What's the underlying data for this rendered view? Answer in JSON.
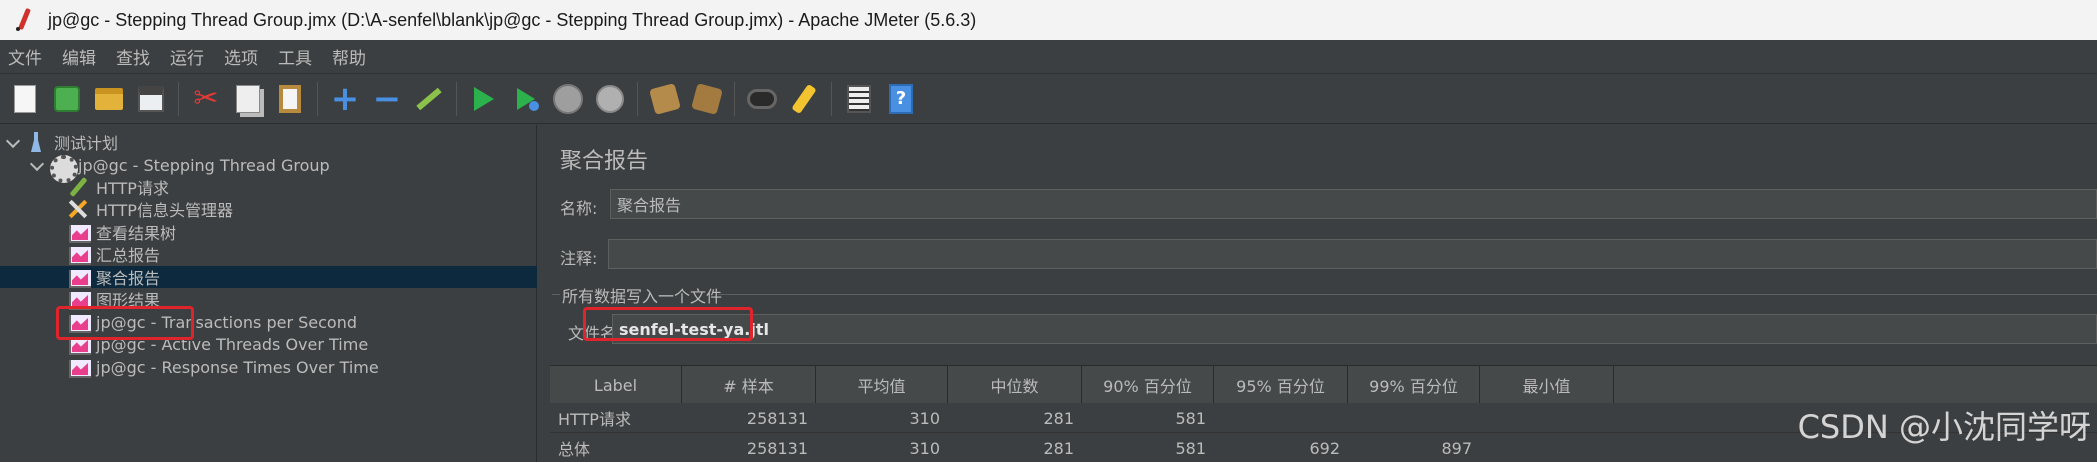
{
  "window": {
    "title": "jp@gc - Stepping Thread Group.jmx (D:\\A-senfel\\blank\\jp@gc - Stepping Thread Group.jmx) - Apache JMeter (5.6.3)"
  },
  "menu": {
    "items": [
      "文件",
      "编辑",
      "查找",
      "运行",
      "选项",
      "工具",
      "帮助"
    ]
  },
  "toolbar": {
    "icons": [
      "new-icon",
      "templates-icon",
      "open-icon",
      "save-icon",
      "cut-icon",
      "copy-icon",
      "paste-icon",
      "expand-icon",
      "collapse-icon",
      "toggle-icon",
      "start-icon",
      "start-no-timers-icon",
      "stop-icon",
      "shutdown-icon",
      "clear-icon",
      "clear-all-icon",
      "search-icon",
      "reset-search-icon",
      "function-helper-icon",
      "help-icon"
    ],
    "help_glyph": "?"
  },
  "tree": {
    "items": [
      {
        "label": "测试计划",
        "icon": "test-plan-icon"
      },
      {
        "label": "jp@gc - Stepping Thread Group",
        "icon": "thread-group-icon"
      },
      {
        "label": "HTTP请求",
        "icon": "sampler-icon"
      },
      {
        "label": "HTTP信息头管理器",
        "icon": "config-icon"
      },
      {
        "label": "查看结果树",
        "icon": "listener-icon"
      },
      {
        "label": "汇总报告",
        "icon": "listener-icon"
      },
      {
        "label": "聚合报告",
        "icon": "listener-icon",
        "selected": true
      },
      {
        "label": "图形结果",
        "icon": "listener-icon"
      },
      {
        "label": "jp@gc - Transactions per Second",
        "icon": "listener-icon"
      },
      {
        "label": "jp@gc - Active Threads Over Time",
        "icon": "listener-icon"
      },
      {
        "label": "jp@gc - Response Times Over Time",
        "icon": "listener-icon"
      }
    ]
  },
  "panel": {
    "title": "聚合报告",
    "name_label": "名称:",
    "name_value": "聚合报告",
    "comment_label": "注释:",
    "comment_value": "",
    "group_title": "所有数据写入一个文件",
    "file_label": "文件名",
    "file_value": "senfel-test-ya.jtl"
  },
  "table": {
    "columns": [
      "Label",
      "# 样本",
      "平均值",
      "中位数",
      "90% 百分位",
      "95% 百分位",
      "99% 百分位",
      "最小值"
    ],
    "rows": [
      [
        "HTTP请求",
        "258131",
        "310",
        "281",
        "581",
        "",
        "",
        ""
      ],
      [
        "总体",
        "258131",
        "310",
        "281",
        "581",
        "692",
        "897",
        ""
      ]
    ]
  },
  "watermark": "CSDN @小沈同学呀",
  "colors": {
    "background": "#3c3f41",
    "selection": "#0d293e",
    "highlight_box": "#e0242b"
  }
}
